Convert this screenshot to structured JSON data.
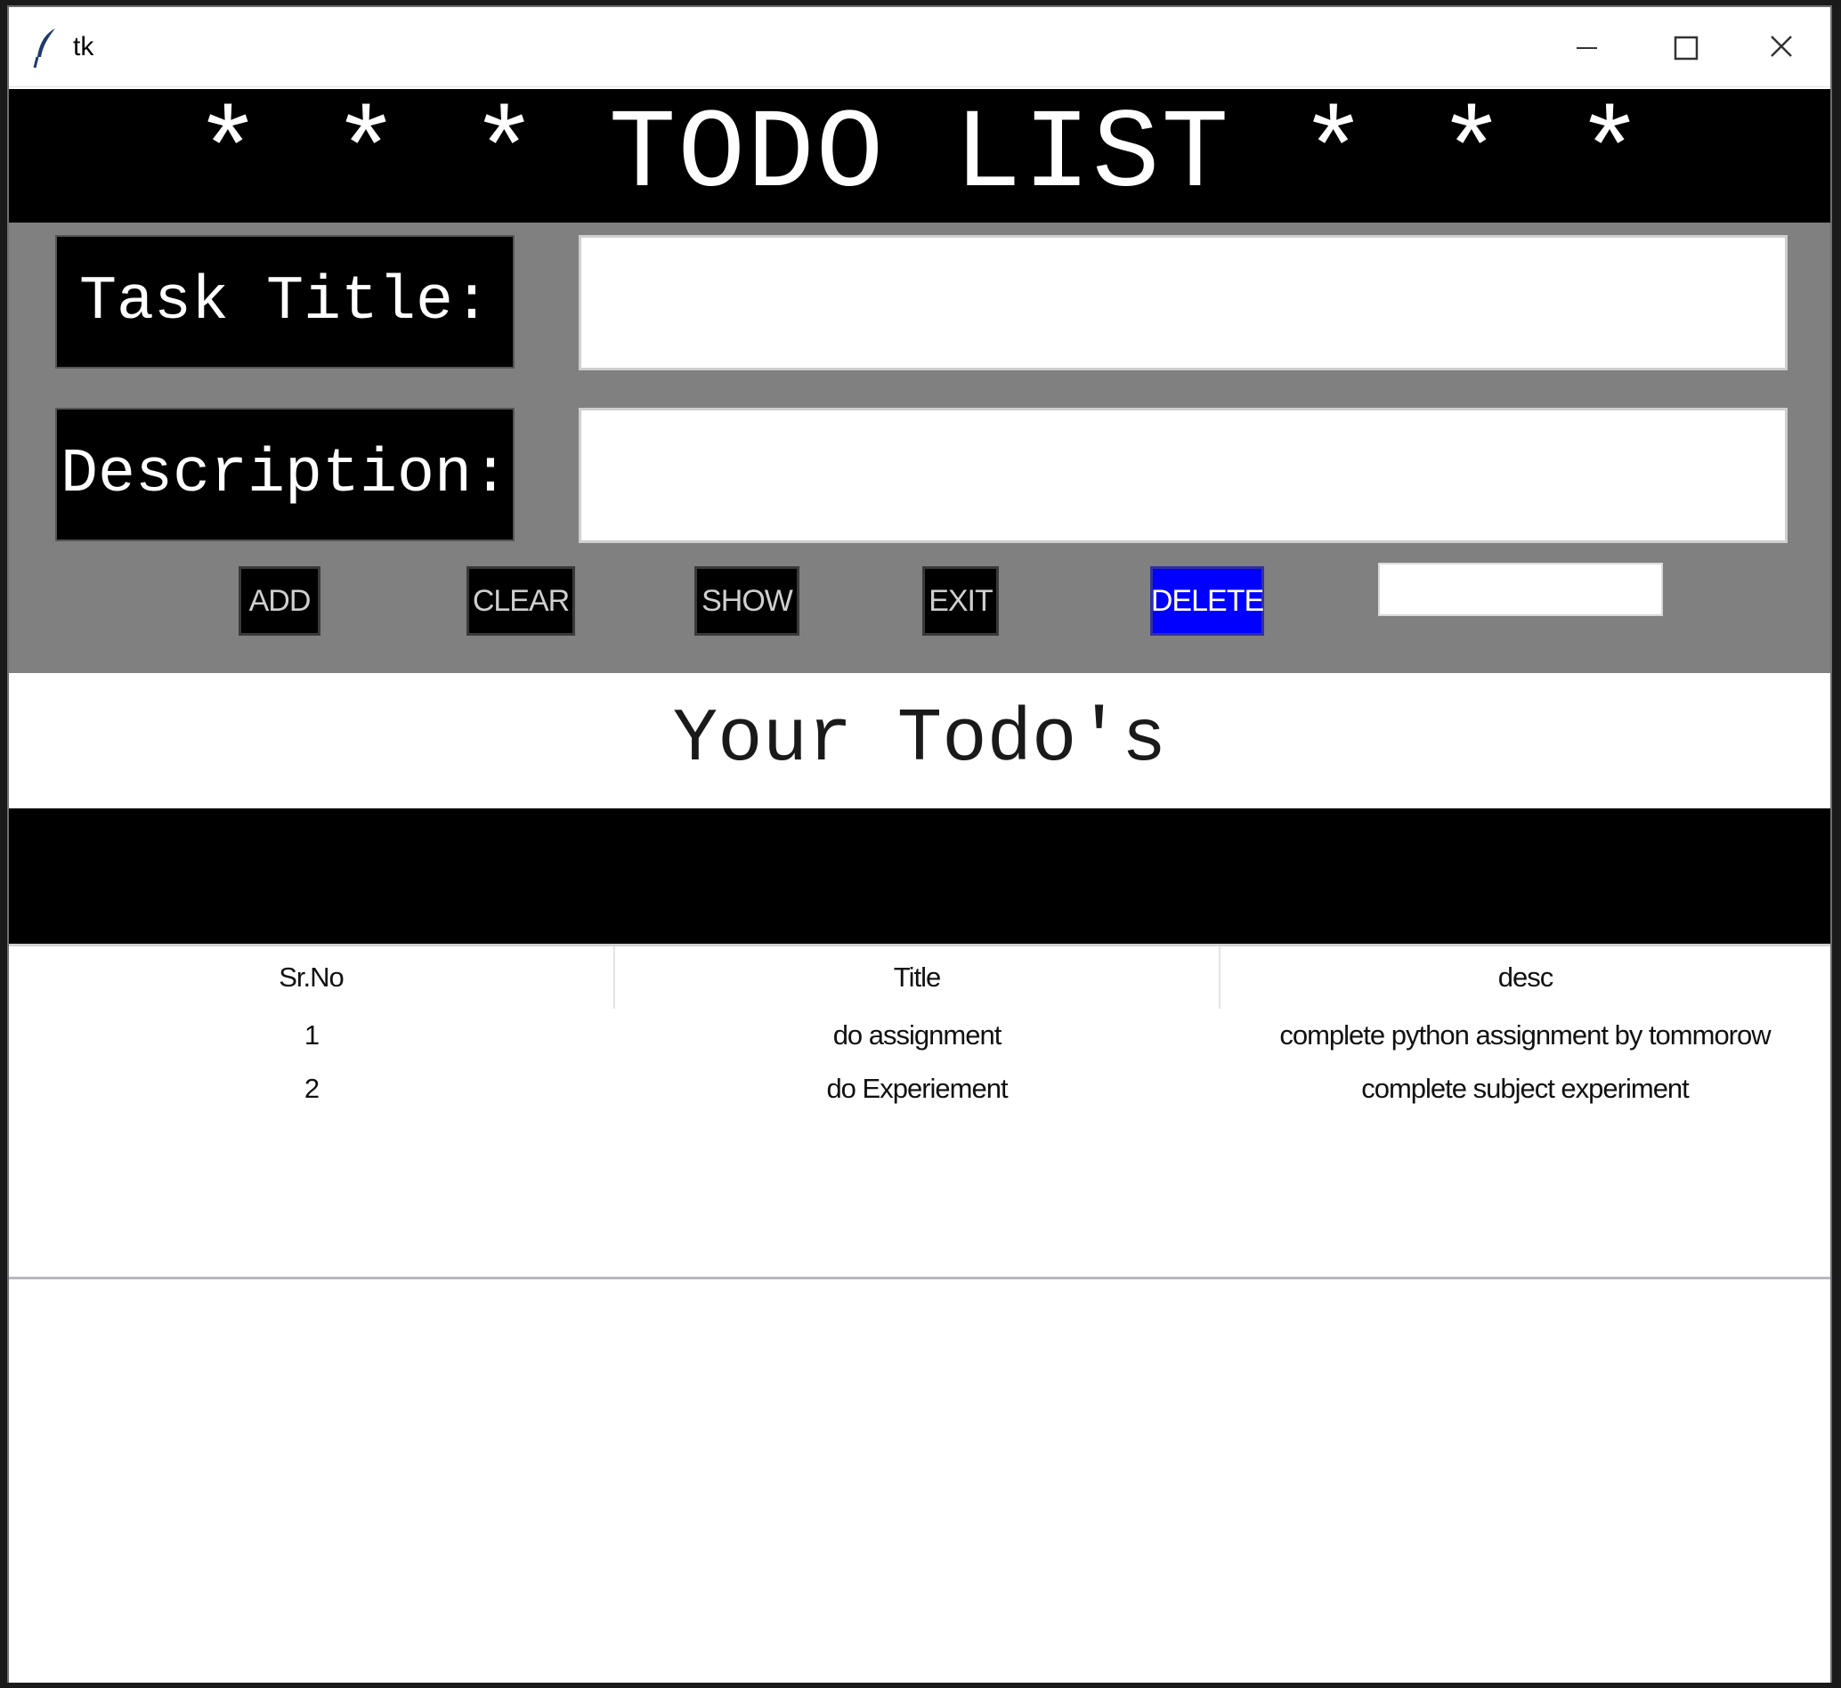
{
  "window": {
    "title": "tk"
  },
  "header": {
    "title": "* * * TODO LIST * * *"
  },
  "form": {
    "task_title_label": "Task Title:",
    "description_label": "Description:",
    "task_title_value": "",
    "description_value": "",
    "delete_index_value": ""
  },
  "buttons": {
    "add": "ADD",
    "clear": "CLEAR",
    "show": "SHOW",
    "exit": "EXIT",
    "delete": "DELETE"
  },
  "todos_section": {
    "heading": "Your Todo's"
  },
  "table": {
    "columns": [
      "Sr.No",
      "Title",
      "desc"
    ],
    "rows": [
      [
        "1",
        "do assignment",
        "complete python assignment by tommorow"
      ],
      [
        "2",
        "do Experiement",
        "complete subject experiment"
      ]
    ]
  },
  "colors": {
    "header_bg": "#000000",
    "form_bg": "#808080",
    "delete_button_bg": "#0000ff"
  }
}
